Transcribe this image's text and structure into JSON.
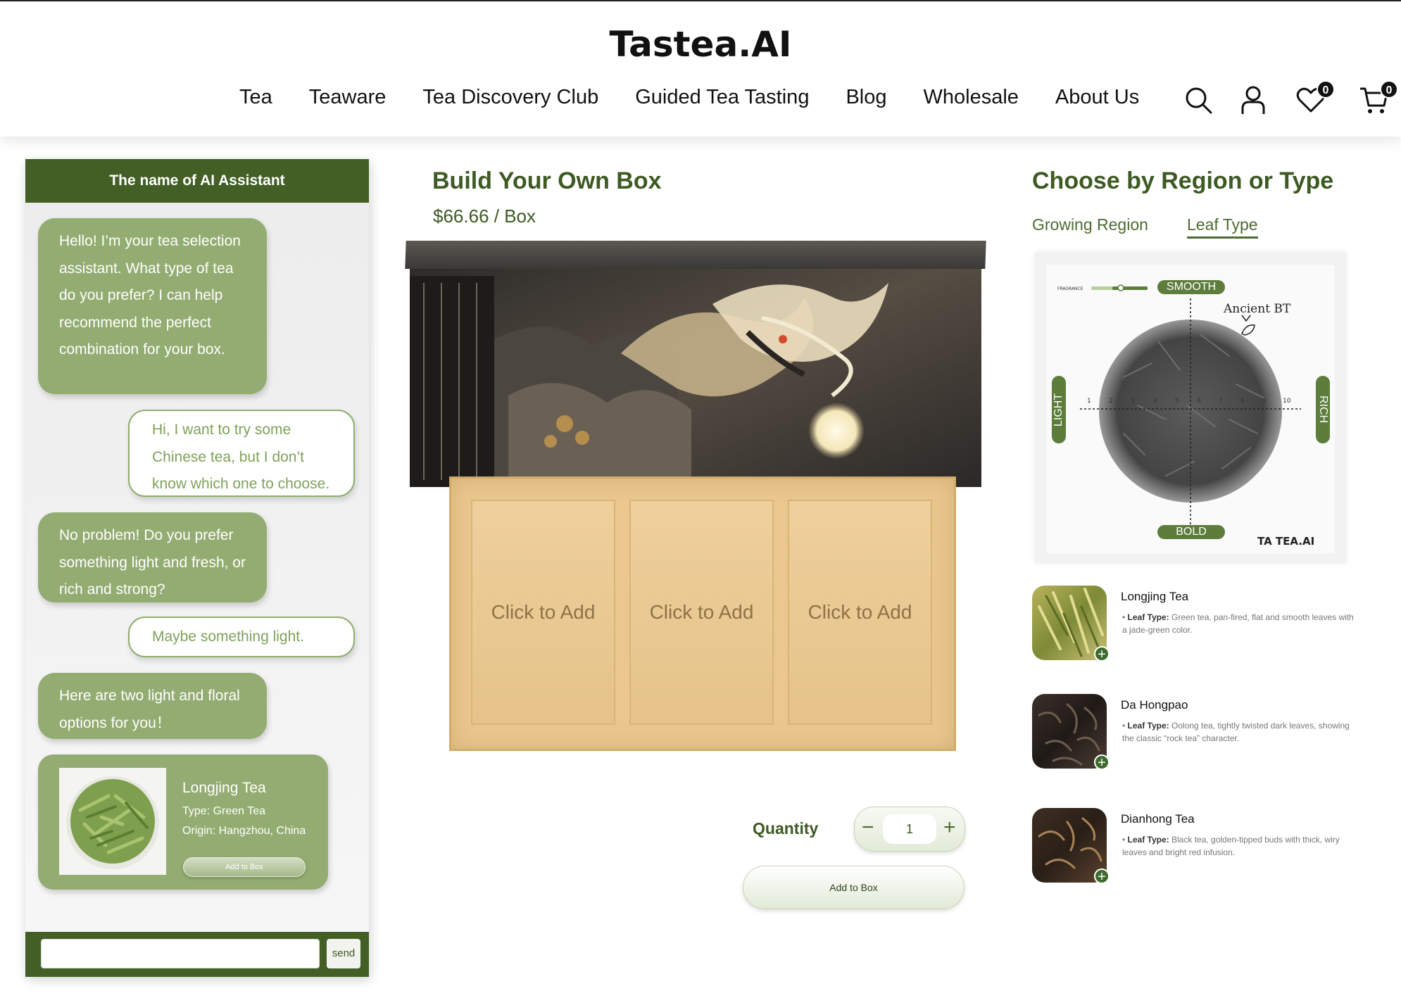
{
  "header": {
    "brand": "Tastea.AI",
    "nav": [
      "Tea",
      "Teaware",
      "Tea Discovery Club",
      "Guided Tea Tasting",
      "Blog",
      "Wholesale",
      "About Us"
    ],
    "wishlist_count": "0",
    "cart_count": "0"
  },
  "chat": {
    "title": "The name of AI Assistant",
    "messages": [
      {
        "from": "ai",
        "text": "Hello! I’m your tea selection assistant. What type of tea do you prefer? I can help recommend the perfect combination for your box."
      },
      {
        "from": "user",
        "text": "Hi, I want to try some Chinese tea, but I don’t know which one to choose."
      },
      {
        "from": "ai",
        "text": "No problem! Do you prefer something light and fresh, or rich and strong?"
      },
      {
        "from": "user",
        "text": "Maybe something light."
      },
      {
        "from": "ai",
        "text": "Here are two light and floral options for you！"
      }
    ],
    "card": {
      "name": "Longjing Tea",
      "type": "Type: Green Tea",
      "origin": "Origin: Hangzhou, China",
      "button": "Add to Box"
    },
    "send_label": "send"
  },
  "builder": {
    "title": "Build Your Own Box",
    "price": "$66.66 / Box",
    "slots": [
      "Click to Add",
      "Click to Add",
      "Click to Add"
    ],
    "quantity_label": "Quantity",
    "quantity_value": "1",
    "add_button": "Add to Box"
  },
  "chooser": {
    "title": "Choose by Region or Type",
    "tabs": [
      "Growing Region",
      "Leaf Type"
    ],
    "active_tab": "Leaf Type",
    "radar": {
      "top": "SMOOTH",
      "bottom": "BOLD",
      "left": "LIGHT",
      "right": "RICH",
      "tea_name": "Ancient BT",
      "fragrance_label": "FRAGRANCE",
      "logo": "TA TEA.AI",
      "axis_ticks": [
        "1",
        "2",
        "3",
        "4",
        "5",
        "6",
        "7",
        "8",
        "9",
        "10"
      ]
    },
    "teas": [
      {
        "name": "Longjing Tea",
        "label": "Leaf Type:",
        "desc": "Green tea, pan-fired, flat and smooth leaves with a jade-green color."
      },
      {
        "name": "Da Hongpao",
        "label": "Leaf Type:",
        "desc": "Oolong tea, tightly twisted dark leaves, showing the classic “rock tea” character."
      },
      {
        "name": "Dianhong Tea",
        "label": "Leaf Type:",
        "desc": "Black tea, golden-tipped buds with thick, wiry leaves and bright red infusion."
      }
    ]
  },
  "colors": {
    "brand_green": "#435f25",
    "bubble_green": "#93ac71",
    "tray_gold": "#e9c78e"
  }
}
